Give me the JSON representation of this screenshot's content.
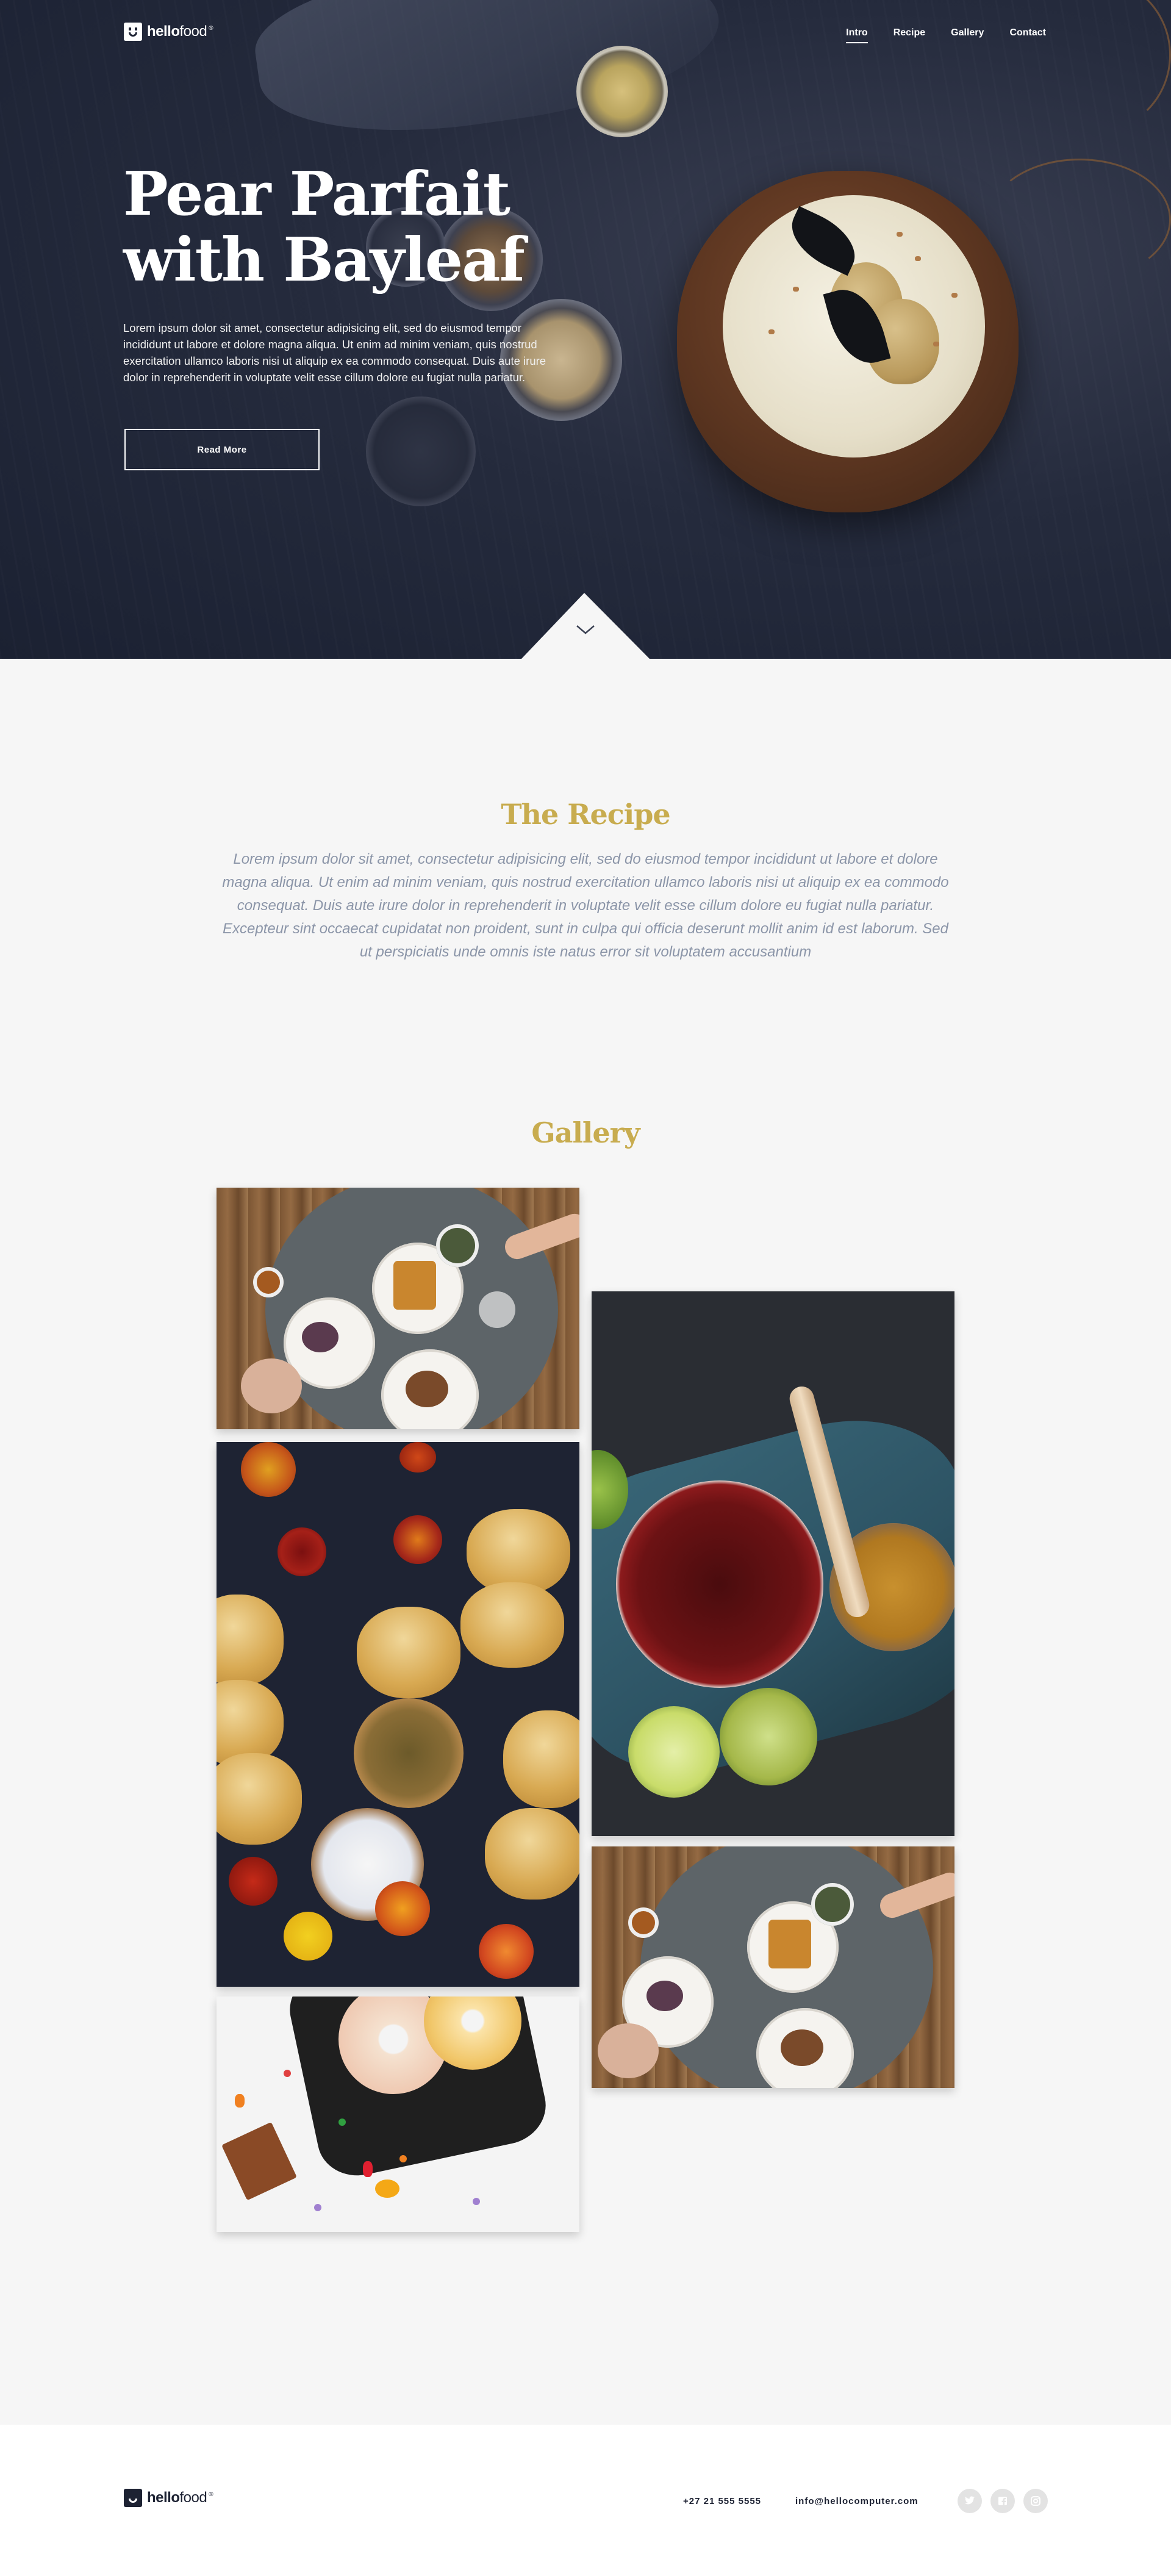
{
  "brand": {
    "name_bold": "hello",
    "name_light": "food",
    "registered": "®"
  },
  "nav": {
    "items": [
      {
        "label": "Intro",
        "active": true
      },
      {
        "label": "Recipe",
        "active": false
      },
      {
        "label": "Gallery",
        "active": false
      },
      {
        "label": "Contact",
        "active": false
      }
    ]
  },
  "hero": {
    "title_line1": "Pear Parfait",
    "title_line2": "with Bayleaf",
    "text": "Lorem ipsum dolor sit amet, consectetur adipisicing elit, sed do eiusmod tempor incididunt ut labore et dolore magna aliqua. Ut enim ad minim veniam, quis nostrud exercitation ullamco laboris nisi ut aliquip ex ea commodo consequat. Duis aute irure dolor in reprehenderit in voluptate velit esse cillum dolore eu fugiat nulla pariatur.",
    "button_label": "Read More",
    "scroll_icon": "chevron-down-icon"
  },
  "recipe": {
    "title": "The Recipe",
    "text": "Lorem ipsum dolor sit amet, consectetur adipisicing elit, sed do eiusmod tempor incididunt ut labore et dolore magna aliqua. Ut enim ad minim veniam, quis nostrud exercitation ullamco laboris nisi ut aliquip ex ea commodo consequat. Duis aute irure dolor in reprehenderit in voluptate velit esse cillum dolore eu fugiat nulla pariatur. Excepteur sint occaecat cupidatat non proident, sunt in culpa qui officia deserunt mollit anim id est laborum. Sed ut perspiciatis unde omnis iste natus error sit voluptatem accusantium"
  },
  "gallery": {
    "title": "Gallery",
    "images": [
      "brunch-table-photo",
      "scones-photo",
      "donuts-photo",
      "tea-honey-photo",
      "brunch-table-photo-2"
    ]
  },
  "footer": {
    "phone": "+27 21 555 5555",
    "email": "info@hellocomputer.com",
    "social_icons": [
      "twitter-icon",
      "facebook-icon",
      "instagram-icon"
    ]
  },
  "colors": {
    "hero_bg": "#1f2536",
    "accent_gold": "#c8ac4f",
    "recipe_text": "#8b95a8",
    "page_bg": "#f6f6f6",
    "footer_bg": "#ffffff"
  }
}
